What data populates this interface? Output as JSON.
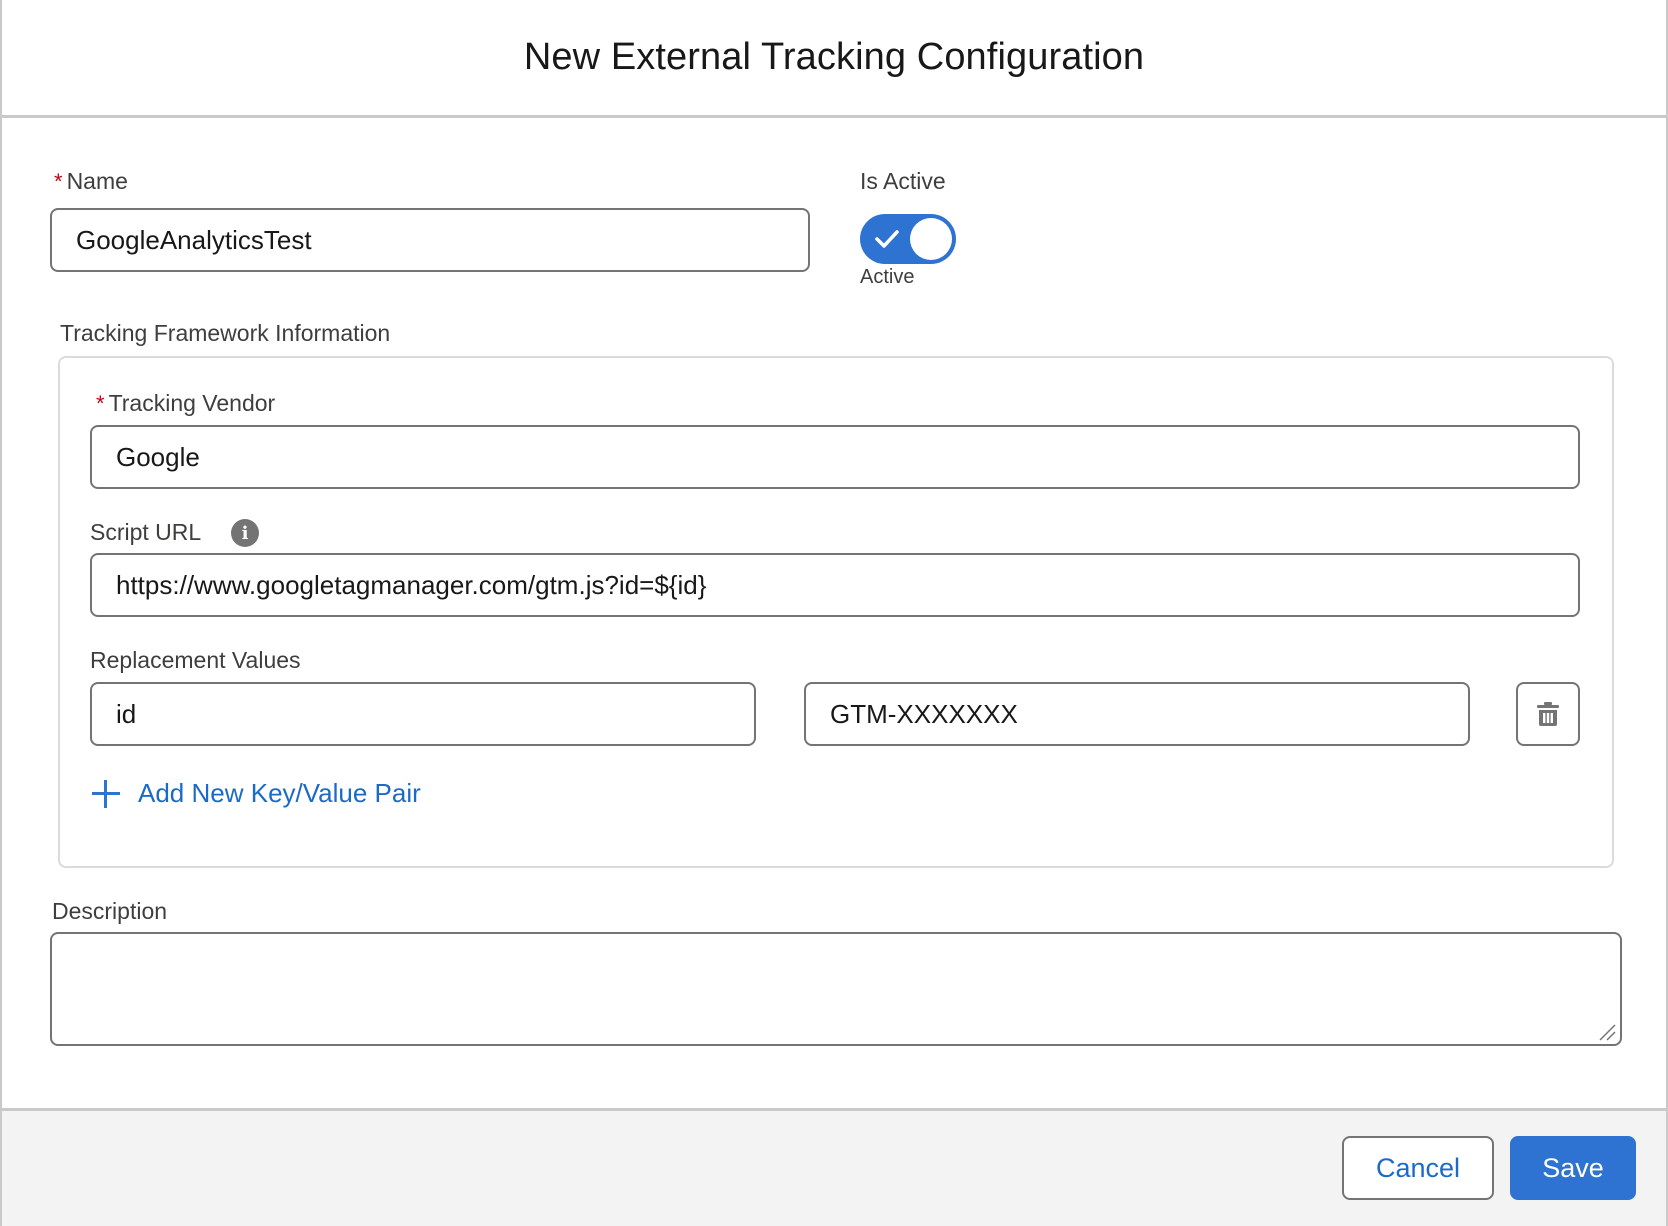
{
  "header": {
    "title": "New External Tracking Configuration"
  },
  "form": {
    "name": {
      "label": "Name",
      "required_marker": "*",
      "value": "GoogleAnalyticsTest"
    },
    "is_active": {
      "label": "Is Active",
      "state_label": "Active",
      "checked": true
    },
    "tracking_framework": {
      "legend": "Tracking Framework Information",
      "vendor": {
        "label": "Tracking Vendor",
        "required_marker": "*",
        "value": "Google"
      },
      "script_url": {
        "label": "Script URL",
        "info_glyph": "i",
        "value": "https://www.googletagmanager.com/gtm.js?id=${id}"
      },
      "replacement_values": {
        "label": "Replacement Values",
        "pairs": [
          {
            "key": "id",
            "value": "GTM-XXXXXXX"
          }
        ],
        "delete_icon": "trash-icon",
        "add_label": "Add New Key/Value Pair"
      }
    },
    "description": {
      "label": "Description",
      "value": ""
    }
  },
  "footer": {
    "cancel_label": "Cancel",
    "save_label": "Save"
  },
  "colors": {
    "brand": "#2e73d1",
    "link": "#1b6ac9",
    "required": "#ba0517",
    "border": "#747474"
  }
}
